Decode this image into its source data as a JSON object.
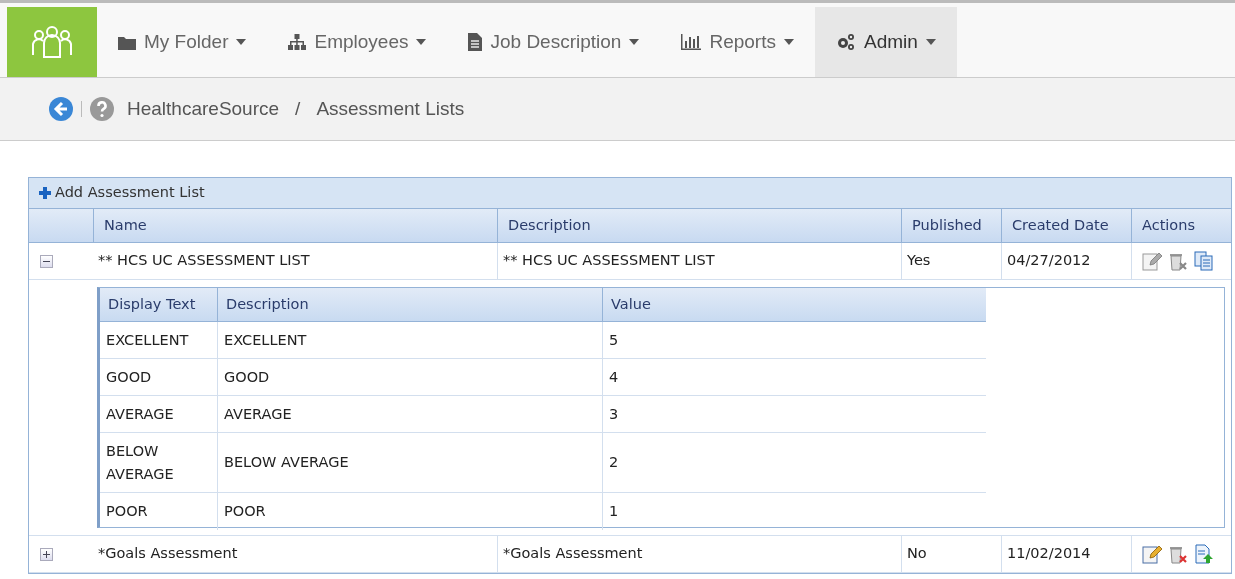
{
  "nav": [
    {
      "label": "My Folder",
      "selected": false
    },
    {
      "label": "Employees",
      "selected": false
    },
    {
      "label": "Job Description",
      "selected": false
    },
    {
      "label": "Reports",
      "selected": false
    },
    {
      "label": "Admin",
      "selected": true
    }
  ],
  "breadcrumb": [
    "HealthcareSource",
    "/",
    "Assessment Lists"
  ],
  "toolbar": {
    "add_label": "Add Assessment List"
  },
  "table": {
    "columns": [
      "Name",
      "Description",
      "Published",
      "Created Date",
      "Actions"
    ],
    "rows": [
      {
        "name": "** HCS UC ASSESSMENT LIST",
        "description": "** HCS UC ASSESSMENT LIST",
        "published": "Yes",
        "created": "04/27/2012",
        "expanded": true,
        "actions": [
          {
            "kind": "edit",
            "disabled": true
          },
          {
            "kind": "delete",
            "disabled": true
          },
          {
            "kind": "copy",
            "disabled": false
          }
        ],
        "detail": {
          "columns": [
            "Display Text",
            "Description",
            "Value"
          ],
          "rows": [
            [
              "EXCELLENT",
              "EXCELLENT",
              "5"
            ],
            [
              "GOOD",
              "GOOD",
              "4"
            ],
            [
              "AVERAGE",
              "AVERAGE",
              "3"
            ],
            [
              "BELOW AVERAGE",
              "BELOW AVERAGE",
              "2"
            ],
            [
              "POOR",
              "POOR",
              "1"
            ]
          ]
        }
      },
      {
        "name": "*Goals Assessment",
        "description": "*Goals Assessment",
        "published": "No",
        "created": "11/02/2014",
        "expanded": false,
        "actions": [
          {
            "kind": "edit",
            "disabled": false
          },
          {
            "kind": "delete",
            "disabled": false
          },
          {
            "kind": "publish",
            "disabled": false
          }
        ]
      }
    ]
  }
}
